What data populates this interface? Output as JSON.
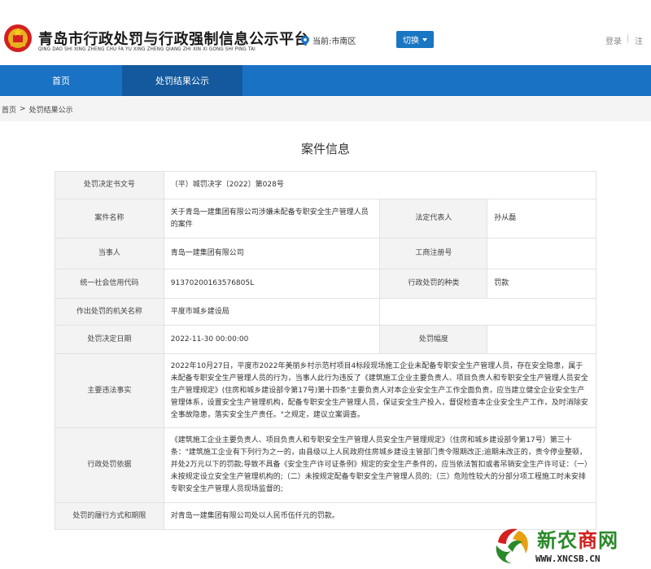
{
  "header": {
    "site_title": "青岛市行政处罚与行政强制信息公示平台",
    "site_pinyin": "QING DAO SHI XING ZHENG CHU FA YU XING ZHENG QIANG ZHI XIN XI GONG SHI PING TAI",
    "location_label": "当前:市南区",
    "switch_label": "切换",
    "login_label": "登录",
    "separator": "|",
    "register_label": "注"
  },
  "nav": {
    "items": [
      {
        "label": "首页"
      },
      {
        "label": "处罚结果公示",
        "active": true
      }
    ]
  },
  "breadcrumb": {
    "home": "首页",
    "sep": ">",
    "current": "处罚结果公示"
  },
  "page_title": "案件信息",
  "case": {
    "doc_no_label": "处罚决定书文号",
    "doc_no": "（平）城罚决字〔2022〕第028号",
    "case_name_label": "案件名称",
    "case_name": "关于青岛一建集团有限公司涉嫌未配备专职安全生产管理人员的案件",
    "legal_rep_label": "法定代表人",
    "legal_rep": "孙从磊",
    "party_label": "当事人",
    "party": "青岛一建集团有限公司",
    "biz_reg_label": "工商注册号",
    "biz_reg": "",
    "credit_code_label": "统一社会信用代码",
    "credit_code": "91370200163576805L",
    "penalty_type_label": "行政处罚的种类",
    "penalty_type": "罚款",
    "authority_label": "作出处罚的机关名称",
    "authority": "平度市城乡建设局",
    "decision_date_label": "处罚决定日期",
    "decision_date": "2022-11-30 00:00:00",
    "penalty_range_label": "处罚幅度",
    "penalty_range": "",
    "facts_label": "主要违法事实",
    "facts": "2022年10月27日，平度市2022年美丽乡村示范村项目4标段现场施工企业未配备专职安全生产管理人员，存在安全隐患，属于未配备专职安全生产管理人员的行为，当事人此行为违反了《建筑施工企业主要负责人、项目负责人和专职安全生产管理人员安全生产管理规定》(住房和城乡建设部令第17号)第十四条\"主要负责人对本企业安全生产工作全面负责，应当建立健全企业安全生产管理体系，设置安全生产管理机构，配备专职安全生产管理人员，保证安全生产投入，督促检查本企业安全生产工作，及时消除安全事故隐患，落实安全生产责任。\"之规定，建议立案调查。",
    "basis_label": "行政处罚依据",
    "basis": "《建筑施工企业主要负责人、项目负责人和专职安全生产管理人员安全生产管理规定》（住房和城乡建设部令第17号）第三十条：\"建筑施工企业有下列行为之一的，由县级以上人民政府住房城乡建设主管部门责令限期改正;逾期未改正的，责令停业整顿，并处2万元以下的罚款;导致不具备《安全生产许可证条例》规定的安全生产条件的，应当依法暂扣或者吊销安全生产许可证：（一）未按规定设立安全生产管理机构的;（二）未按规定配备专职安全生产管理人员的;（三）危险性较大的分部分项工程施工时未安排专职安全生产管理人员现场监督的;",
    "performance_label": "处罚的履行方式和期限",
    "performance": "对青岛一建集团有限公司处以人民币伍仟元的罚款。"
  },
  "watermark": {
    "text_xin": "新农",
    "text_shang": "商",
    "text_wang": "网",
    "url": "WWW.XNCSB.CN",
    "color_green": "#2a8a2a",
    "color_red": "#d42020"
  }
}
